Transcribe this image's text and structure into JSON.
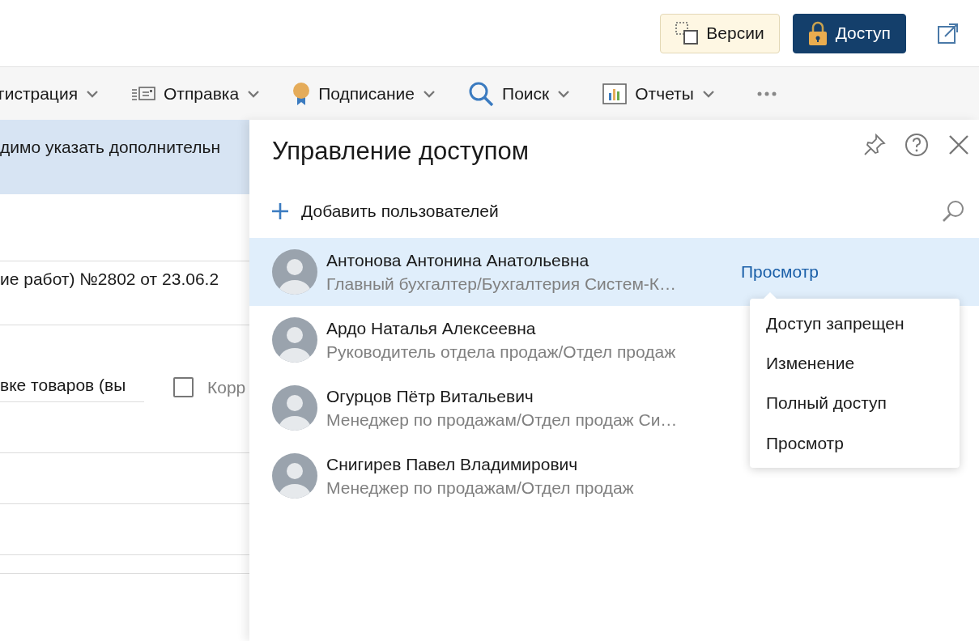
{
  "header": {
    "buttons": [
      {
        "label": "Версии",
        "kind": "versions"
      },
      {
        "label": "Доступ",
        "kind": "access"
      }
    ]
  },
  "toolbar": {
    "items": [
      {
        "label": "гистрация",
        "kind": "register"
      },
      {
        "label": "Отправка",
        "kind": "send"
      },
      {
        "label": "Подписание",
        "kind": "sign"
      },
      {
        "label": "Поиск",
        "kind": "search"
      },
      {
        "label": "Отчеты",
        "kind": "reports"
      }
    ]
  },
  "document": {
    "banner": "димо указать дополнительн",
    "title": "ие работ) №2802 от 23.06.2",
    "field": {
      "value": "вке товаров (вы"
    },
    "checkbox": {
      "label": "Корр",
      "checked": false
    }
  },
  "panel": {
    "title": "Управление доступом",
    "add_users": "Добавить пользователей",
    "users": [
      {
        "name": "Антонова Антонина Анатольевна",
        "position": "Главный бухгалтер/Бухгалтерия Систем-К…",
        "selected": true,
        "access": "Просмотр"
      },
      {
        "name": "Ардо Наталья Алексеевна",
        "position": "Руководитель отдела продаж/Отдел продаж",
        "selected": false
      },
      {
        "name": "Огурцов Пётр Витальевич",
        "position": "Менеджер по продажам/Отдел продаж Си…",
        "selected": false
      },
      {
        "name": "Снигирев Павел Владимирович",
        "position": "Менеджер по продажам/Отдел продаж",
        "selected": false
      }
    ],
    "access_menu": [
      "Доступ запрещен",
      "Изменение",
      "Полный доступ",
      "Просмотр"
    ]
  }
}
